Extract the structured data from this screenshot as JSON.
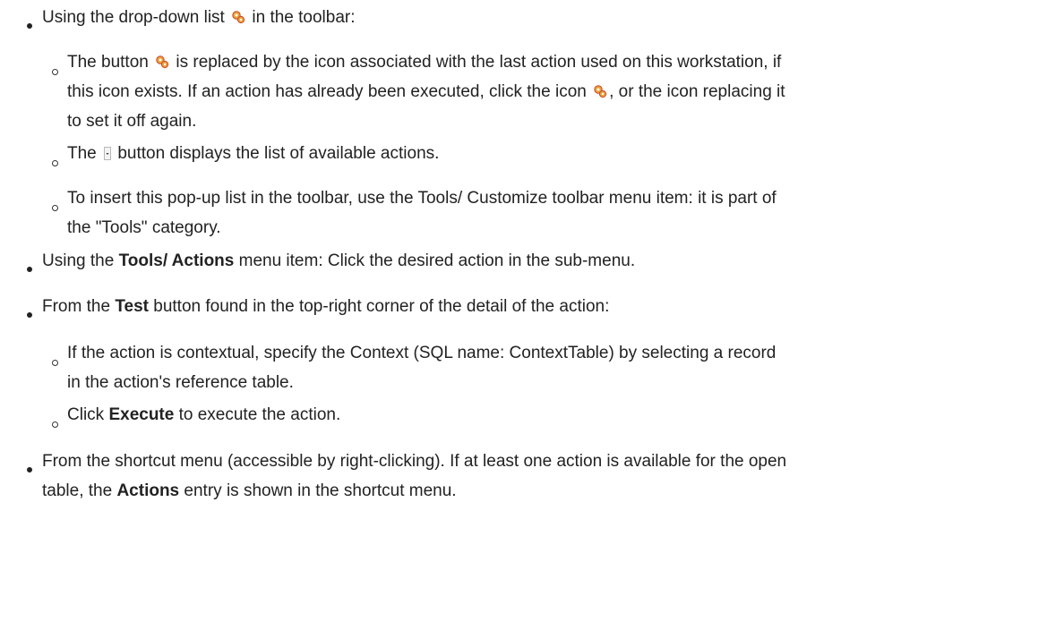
{
  "colors": {
    "text": "#222222",
    "gear_orange": "#e8a33a",
    "gear_red": "#c9482b"
  },
  "p1": {
    "a": "Using the drop-down list",
    "b": "in the toolbar:"
  },
  "p2": {
    "a": "The button",
    "b": "is replaced by the icon associated with the last action used on this workstation, if",
    "c": "this icon exists. If an action has already been executed, click the icon",
    "d": ", or the icon replacing it",
    "e": "to set it off again."
  },
  "p3": {
    "a": "The",
    "b": "button displays the list of available actions."
  },
  "p4": {
    "a": "To insert this pop-up list in the toolbar, use the Tools/ Customize toolbar menu item: it is part of",
    "b": "the \"Tools\" category."
  },
  "p5": {
    "a": "Using the",
    "b": "Tools/ Actions",
    "c": "menu item: Click the desired action in the sub-menu."
  },
  "p6": {
    "a": "From the",
    "b": "Test",
    "c": "button found in the top-right corner of the detail of the action:"
  },
  "p7": {
    "a": "If the action is contextual, specify the Context (SQL name: ContextTable) by selecting a record",
    "b": "in the action's reference table."
  },
  "p8": {
    "a": "Click",
    "b": "Execute",
    "c": "to execute the action."
  },
  "p9": {
    "a": "From the shortcut menu (accessible by right-clicking). If at least one action is available for the open",
    "b": "table, the",
    "c": "Actions",
    "d": "entry is shown in the shortcut menu."
  }
}
